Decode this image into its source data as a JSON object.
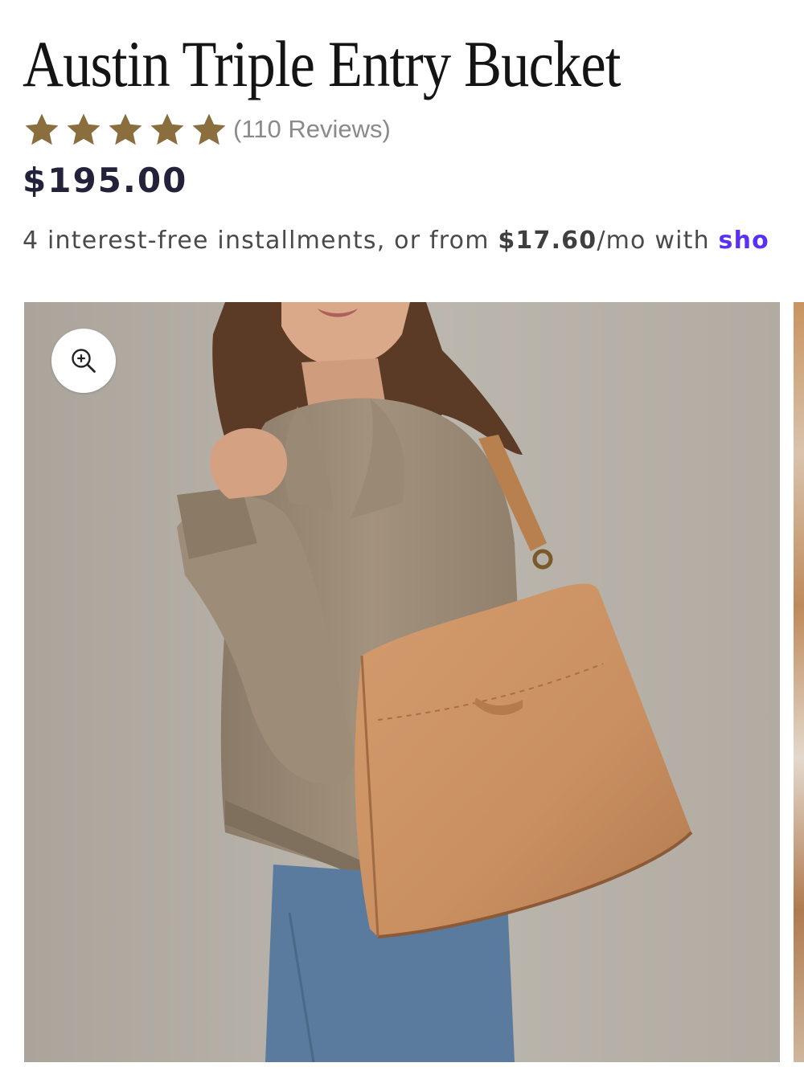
{
  "product": {
    "title": "Austin Triple Entry Bucket",
    "rating": {
      "stars": 5,
      "max_stars": 5,
      "review_count_text": "(110 Reviews)"
    },
    "price": "$195.00",
    "installments": {
      "prefix": "4 interest-free installments, or from ",
      "amount": "$17.60",
      "suffix": "/mo with ",
      "provider": "sho"
    }
  },
  "gallery": {
    "zoom_icon": "zoom-in-icon",
    "image_alt": "Woman in a taupe jacket and jeans carrying a tan leather bucket bag on her shoulder"
  },
  "colors": {
    "star": "#8a6e3e",
    "price": "#23223a",
    "shop_pay": "#5a31f4",
    "image_background": "#b9b3aa",
    "bag": "#c98f61"
  }
}
